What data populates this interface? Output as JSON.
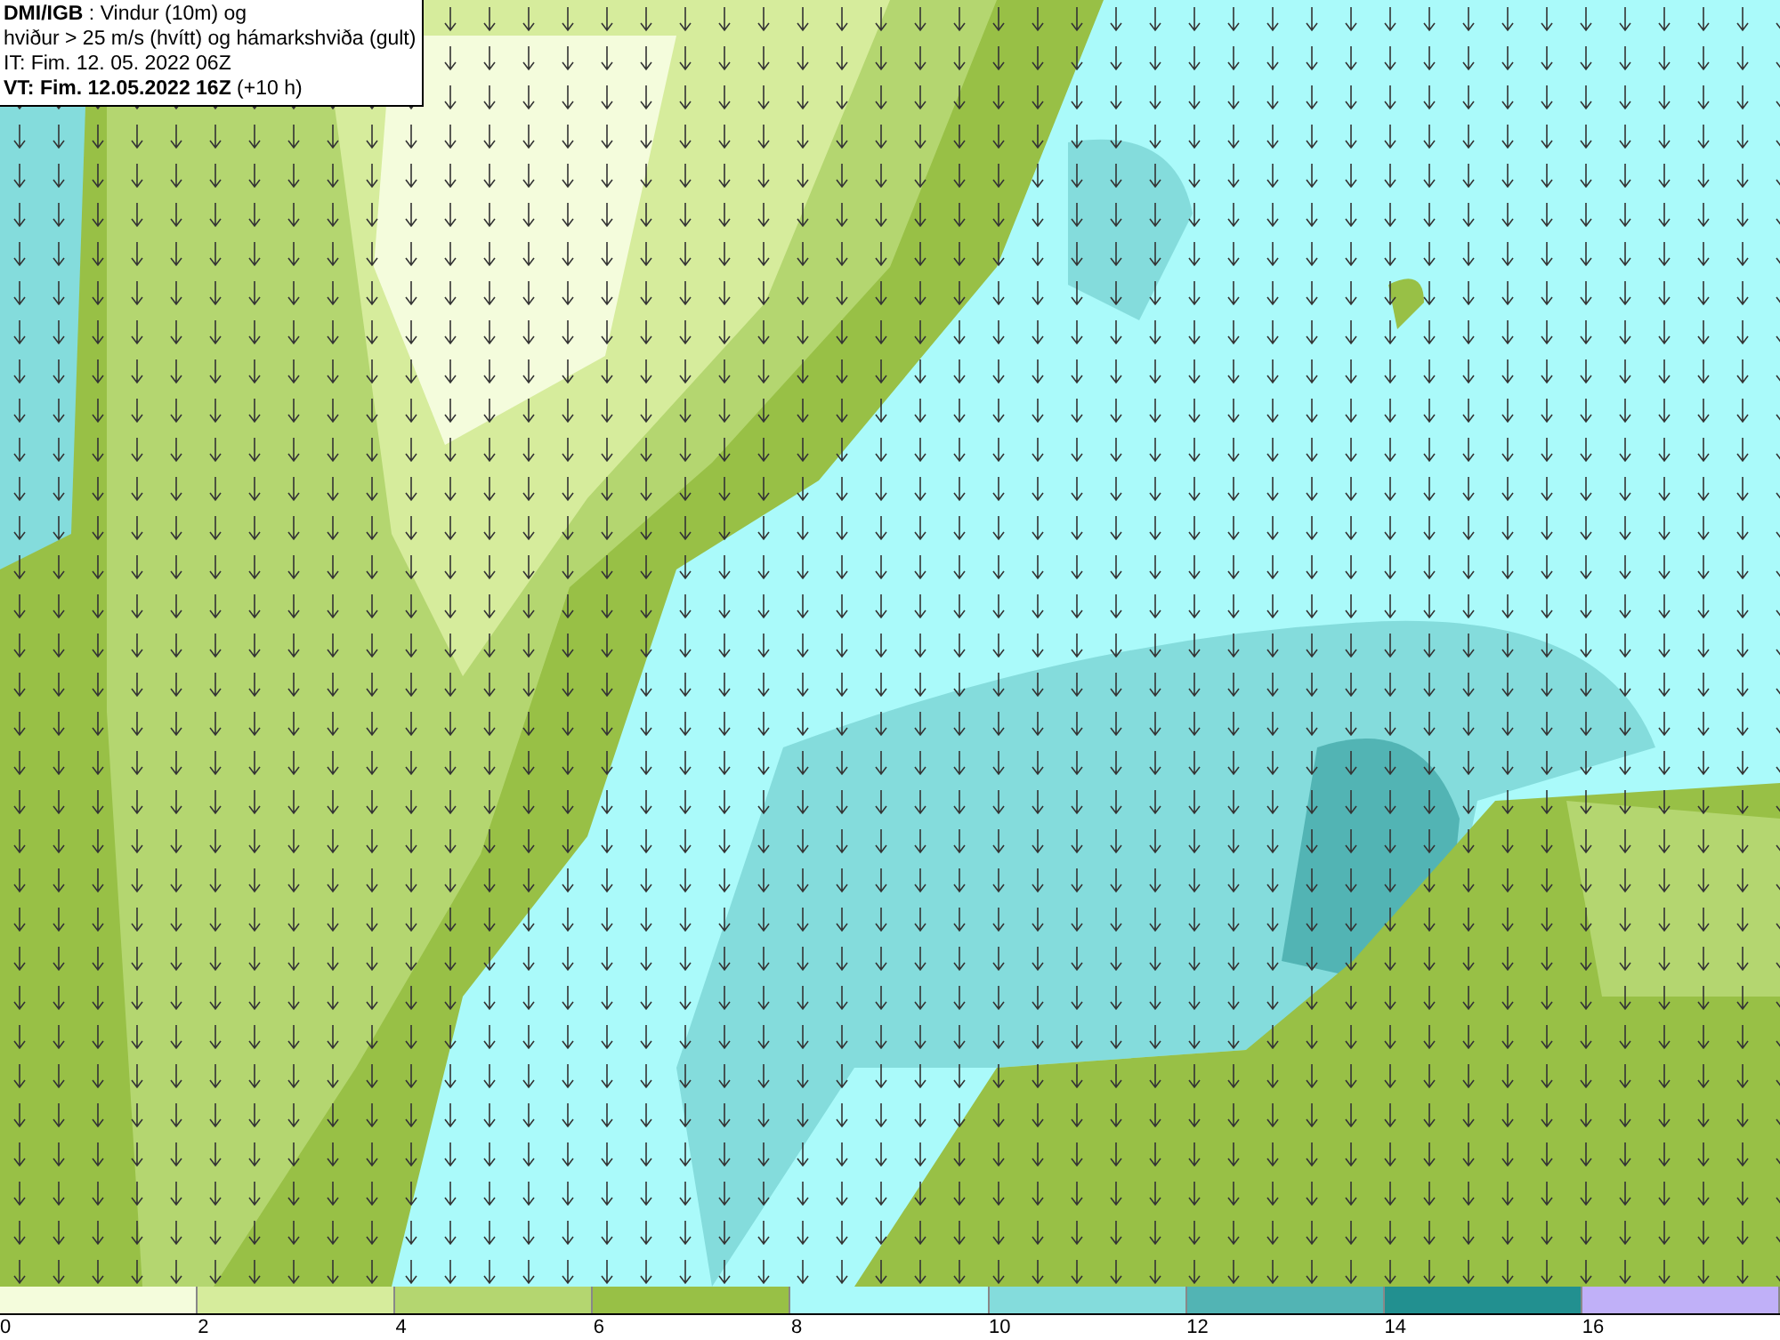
{
  "info_box": {
    "lines": [
      "**DMI/IGB** : Vindur (10m) og",
      "hviður > 25 m/s (hvítt) og hámarkshviða (gult)",
      "IT: Fim. 12. 05. 2022 06Z",
      "**VT: Fim. 12.05.2022 16Z** (+10 h)"
    ]
  },
  "legend": {
    "bins": [
      {
        "label": "0",
        "color": "#f4fcdc"
      },
      {
        "label": "2",
        "color": "#d6ec9c"
      },
      {
        "label": "4",
        "color": "#b4d670"
      },
      {
        "label": "6",
        "color": "#98c046"
      },
      {
        "label": "8",
        "color": "#aafafa"
      },
      {
        "label": "10",
        "color": "#84dcdc"
      },
      {
        "label": "12",
        "color": "#52b4b4"
      },
      {
        "label": "14",
        "color": "#229090"
      },
      {
        "label": "16",
        "color": "#c0b0f8"
      }
    ]
  }
}
